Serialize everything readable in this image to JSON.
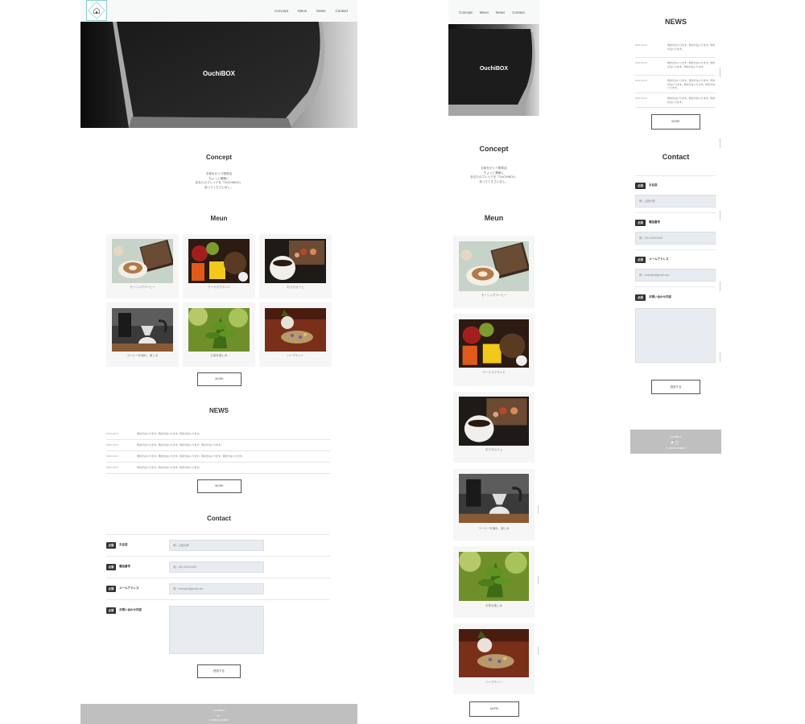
{
  "site": {
    "brand": "OuchiBOX",
    "nav": [
      "Concept",
      "Meun",
      "News",
      "Contact"
    ]
  },
  "concept": {
    "title": "Concept",
    "lines": [
      "お家をかくべ喫茶店",
      "ちょっと素敵に",
      "あなたのブレイクを「OUCHIBOX」",
      "彩ってくださいまし。"
    ]
  },
  "menu": {
    "title": "Meun",
    "items": [
      "モーニングコーヒー",
      "ワードパプランド",
      "おうちカフェ",
      "コーヒーを淹れ、楽しみ",
      "お茶を楽しみ",
      "ハーブティー"
    ],
    "more": "MORE"
  },
  "news": {
    "title": "NEWS",
    "items": [
      {
        "date": "2023.10.01",
        "text": "例文がはいります。例文がはいります。例文がはいります。"
      },
      {
        "date": "2023.10.01",
        "text": "例文がはいります。例文がはいります。例文がはいります。例文がはいります。"
      },
      {
        "date": "2023.10.01",
        "text": "例文がはいります。例文がはいります。例文がはいります。例文がはいります。例文がはいります。"
      },
      {
        "date": "2023.10.01",
        "text": "例文がはいります。例文がはいります。例文がはいります。"
      }
    ],
    "more": "MORE"
  },
  "contact": {
    "title": "Contact",
    "required": "必須",
    "fields": [
      {
        "label": "お名前",
        "placeholder": "例）山田太郎"
      },
      {
        "label": "電話番号",
        "placeholder": "例）000-0000-0000"
      },
      {
        "label": "メールアドレス",
        "placeholder": "例）example@gmail.com"
      },
      {
        "label": "お問い合わせ内容",
        "placeholder": ""
      }
    ],
    "submit": "送信する"
  },
  "footer": {
    "brand": "OuchiBOX",
    "copyright": "© 2023 OuchiBOX"
  },
  "colors": {
    "footer": "#bfbfbf",
    "required_badge": "#333333",
    "input_bg": "#e8ebef"
  },
  "icons": [
    "home-icon",
    "twitter-icon",
    "instagram-icon"
  ]
}
